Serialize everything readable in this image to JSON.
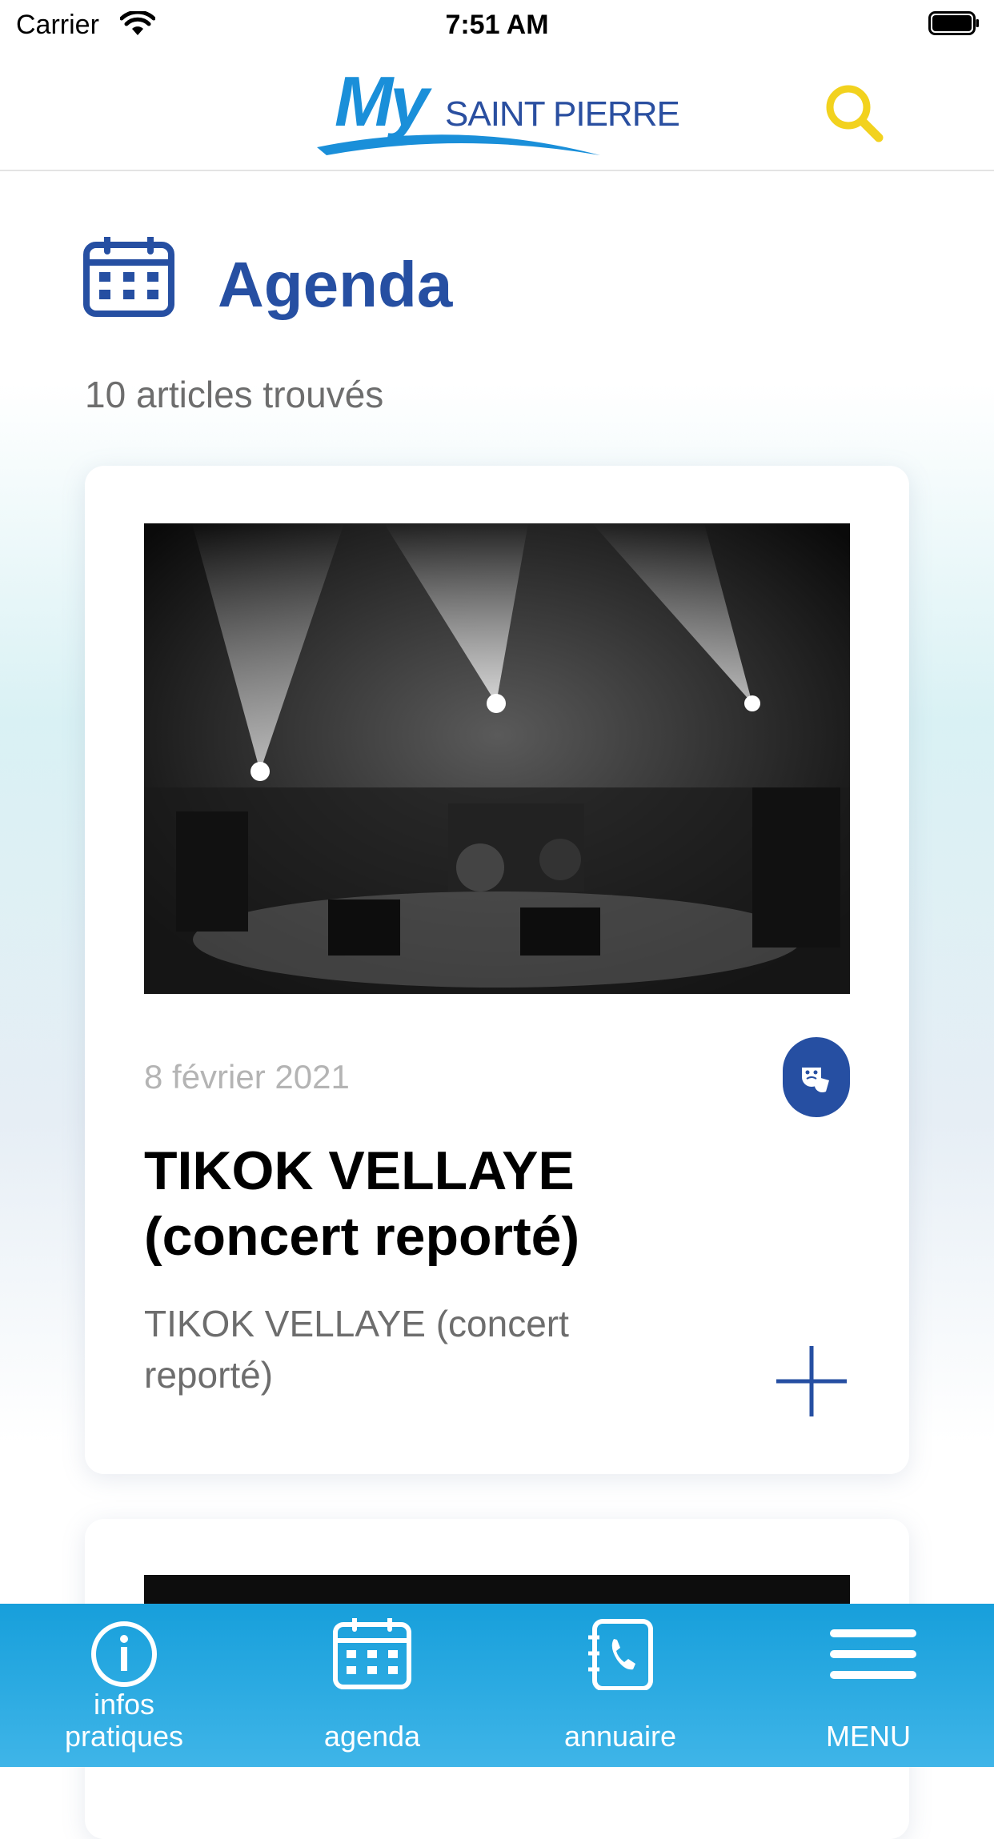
{
  "status_bar": {
    "carrier": "Carrier",
    "time": "7:51 AM"
  },
  "header": {
    "logo_my": "My",
    "logo_city": "SAINT PIERRE",
    "search_icon": "search-icon"
  },
  "page": {
    "title": "Agenda",
    "title_icon": "calendar-icon",
    "results_count": "10 articles trouvés"
  },
  "articles": [
    {
      "date": "8 février 2021",
      "category_icon": "theater-masks-icon",
      "title_line1": "TIKOK VELLAYE",
      "title_line2": "(concert reporté)",
      "description": "TIKOK VELLAYE (concert reporté)",
      "image": "concert-stage-photo"
    }
  ],
  "tabbar": {
    "items": [
      {
        "label_line1": "infos",
        "label_line2": "pratiques",
        "icon": "info-icon"
      },
      {
        "label": "agenda",
        "icon": "calendar-icon"
      },
      {
        "label": "annuaire",
        "icon": "phonebook-icon"
      },
      {
        "label": "MENU",
        "icon": "hamburger-menu-icon"
      }
    ]
  },
  "colors": {
    "brand_blue": "#264fa2",
    "sky_blue": "#1a8fd9",
    "search_yellow": "#f2d21e",
    "tabbar": "#2aa9e0"
  }
}
